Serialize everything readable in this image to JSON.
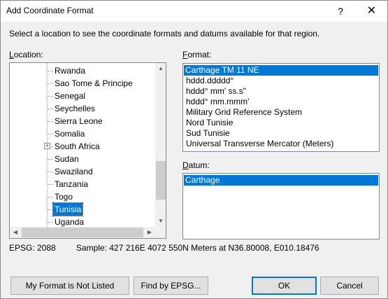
{
  "window": {
    "title": "Add Coordinate Format",
    "help_glyph": "?",
    "close_glyph": "✕"
  },
  "instruction": "Select a location to see the coordinate formats and datums available for that region.",
  "location": {
    "label": "Location:",
    "items": [
      {
        "label": "Rwanda",
        "selected": false,
        "expandable": false
      },
      {
        "label": "Sao Tome & Principe",
        "selected": false,
        "expandable": false
      },
      {
        "label": "Senegal",
        "selected": false,
        "expandable": false
      },
      {
        "label": "Seychelles",
        "selected": false,
        "expandable": false
      },
      {
        "label": "Sierra Leone",
        "selected": false,
        "expandable": false
      },
      {
        "label": "Somalia",
        "selected": false,
        "expandable": false
      },
      {
        "label": "South Africa",
        "selected": false,
        "expandable": true
      },
      {
        "label": "Sudan",
        "selected": false,
        "expandable": false
      },
      {
        "label": "Swaziland",
        "selected": false,
        "expandable": false
      },
      {
        "label": "Tanzania",
        "selected": false,
        "expandable": false
      },
      {
        "label": "Togo",
        "selected": false,
        "expandable": false
      },
      {
        "label": "Tunisia",
        "selected": true,
        "expandable": false
      },
      {
        "label": "Uganda",
        "selected": false,
        "expandable": false
      }
    ],
    "expander_glyph": "+",
    "scroll_up": "▲",
    "scroll_down": "▼",
    "scroll_left": "◀",
    "scroll_right": "▶"
  },
  "format": {
    "label": "Format:",
    "items": [
      {
        "label": "Carthage TM 11 NE",
        "selected": true
      },
      {
        "label": "hddd.ddddd°",
        "selected": false
      },
      {
        "label": "hddd° mm' ss.s\"",
        "selected": false
      },
      {
        "label": "hddd° mm.mmm'",
        "selected": false
      },
      {
        "label": "Military Grid Reference System",
        "selected": false
      },
      {
        "label": "Nord Tunisie",
        "selected": false
      },
      {
        "label": "Sud Tunisie",
        "selected": false
      },
      {
        "label": "Universal Transverse Mercator (Meters)",
        "selected": false
      }
    ]
  },
  "datum": {
    "label": "Datum:",
    "items": [
      {
        "label": "Carthage",
        "selected": true
      }
    ]
  },
  "epsg_text": "EPSG: 2088",
  "sample_text": "Sample: 427 216E  4072 550N Meters at N36.80008, E010.18476",
  "buttons": {
    "not_listed": "My Format is Not Listed",
    "find_epsg": "Find by EPSG...",
    "ok": "OK",
    "cancel": "Cancel"
  },
  "colors": {
    "selection": "#0078d7",
    "dialog_bg": "#f0f0f0",
    "default_button_border": "#0078d7"
  }
}
